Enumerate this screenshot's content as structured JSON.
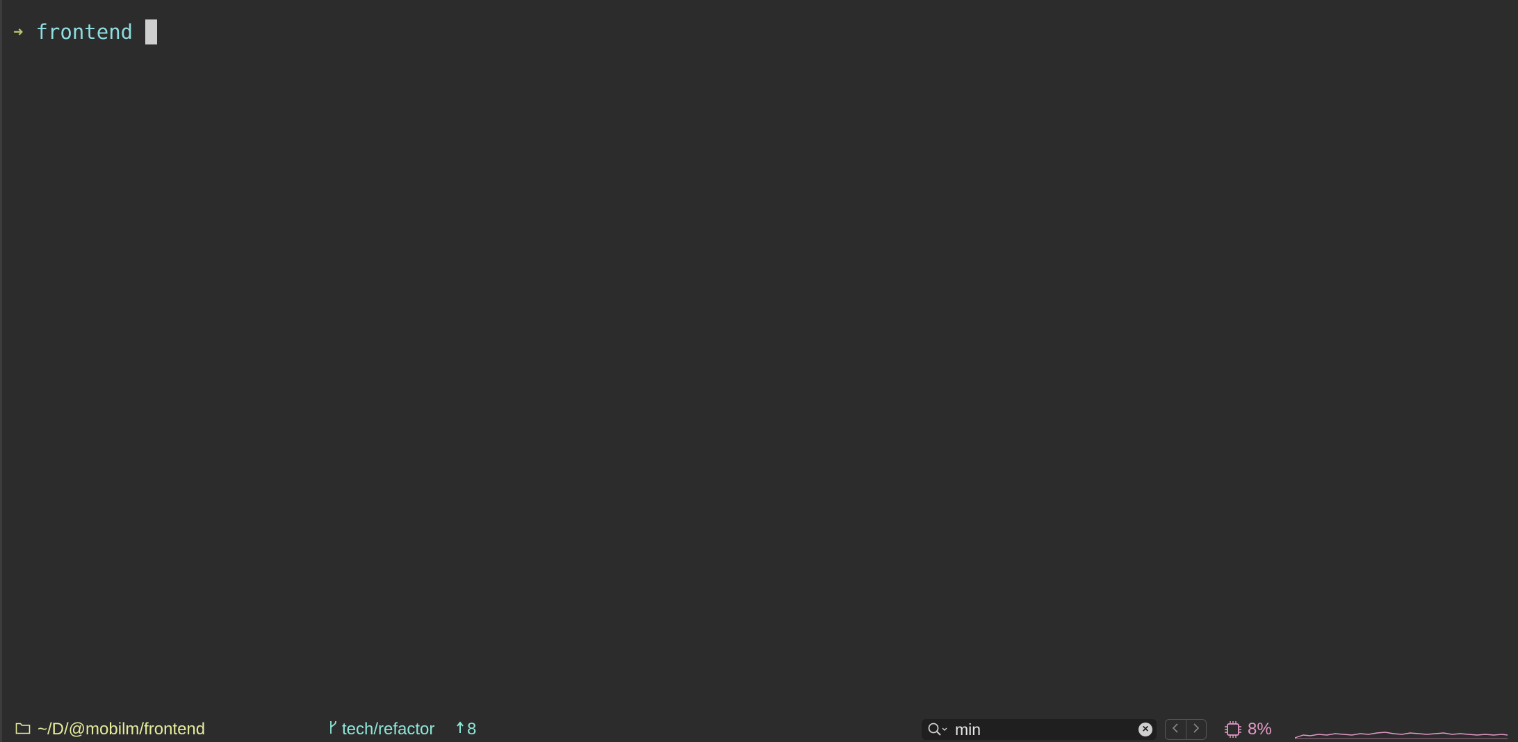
{
  "terminal": {
    "prompt_symbol": "➜",
    "directory": "frontend"
  },
  "statusbar": {
    "path": "~/D/@mobilm/frontend",
    "branch": "tech/refactor",
    "ahead_count": "8",
    "search_value": "min",
    "search_placeholder": "",
    "cpu_percent": "8%",
    "icons": {
      "folder": "folder-icon",
      "branch": "git-branch-icon",
      "ahead": "up-arrow-icon",
      "search": "search-icon",
      "clear": "clear-icon",
      "prev": "chevron-left-icon",
      "next": "chevron-right-icon",
      "cpu": "cpu-icon"
    }
  },
  "colors": {
    "background": "#2c2c2c",
    "prompt_arrow": "#b6c46a",
    "prompt_dir": "#8fdde0",
    "path": "#e6ec9c",
    "git": "#8ee6d9",
    "cpu": "#e59ac7"
  }
}
